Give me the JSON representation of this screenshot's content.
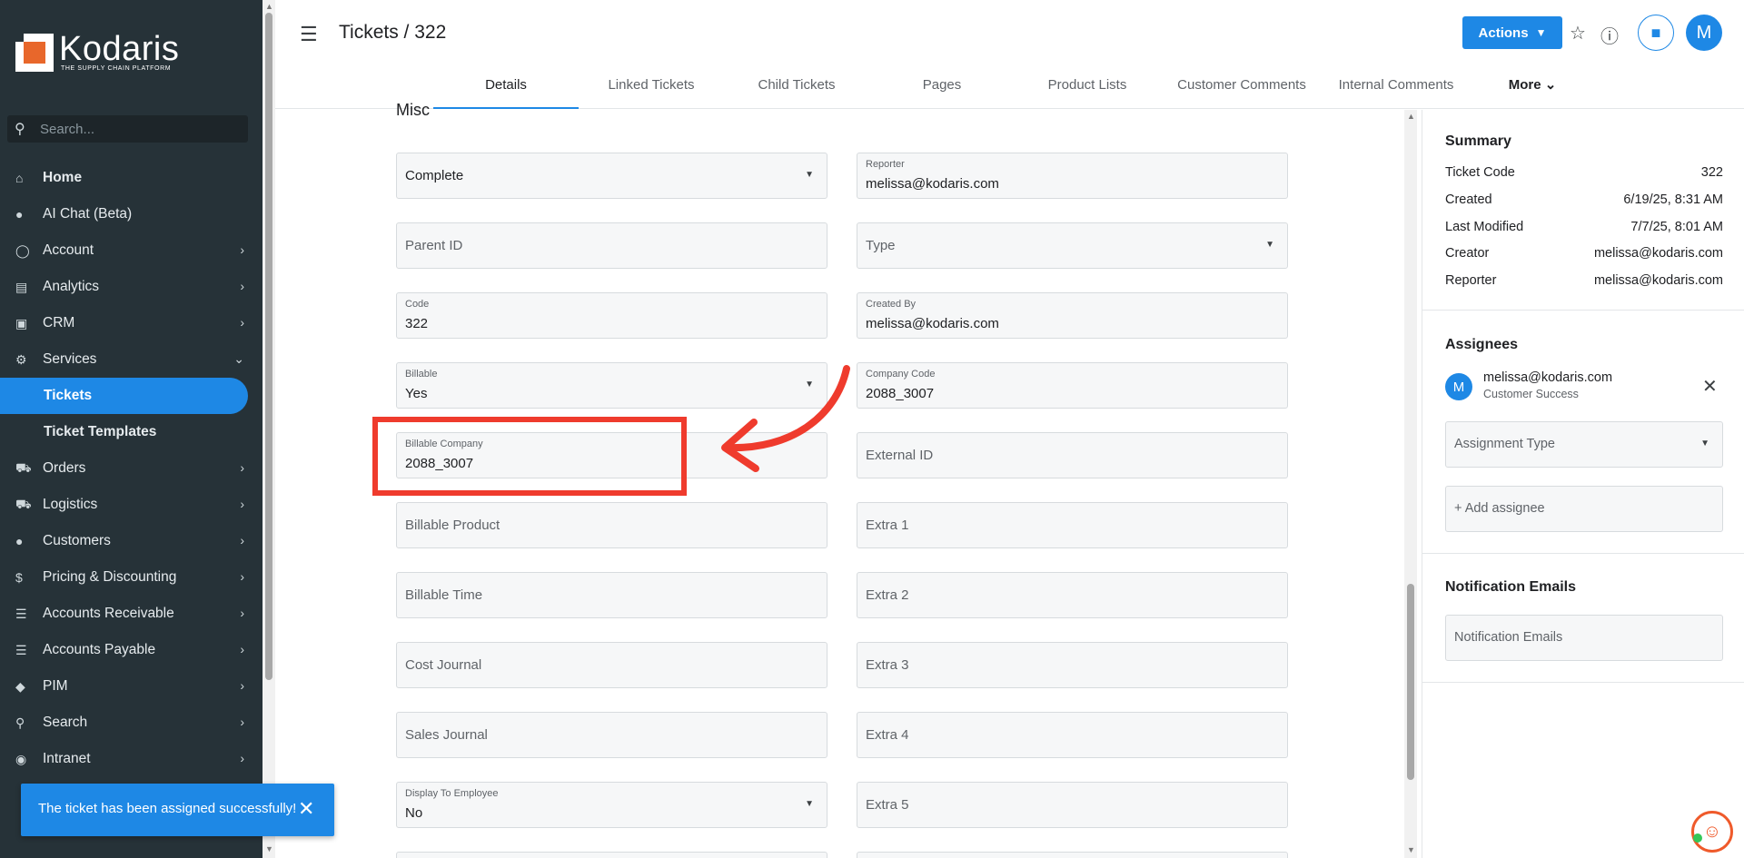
{
  "brand": {
    "name": "Kodaris",
    "tagline": "THE SUPPLY CHAIN PLATFORM"
  },
  "sidebar": {
    "search_placeholder": "Search...",
    "items": [
      {
        "label": "Home",
        "icon": "home-icon",
        "chevron": false
      },
      {
        "label": "AI Chat (Beta)",
        "icon": "robot-icon",
        "chevron": false
      },
      {
        "label": "Account",
        "icon": "person-icon",
        "chevron": true
      },
      {
        "label": "Analytics",
        "icon": "chart-icon",
        "chevron": true
      },
      {
        "label": "CRM",
        "icon": "contact-card-icon",
        "chevron": true
      },
      {
        "label": "Services",
        "icon": "gears-icon",
        "chevron": "down"
      },
      {
        "label": "Tickets",
        "icon": "",
        "chevron": false,
        "active": true
      },
      {
        "label": "Ticket Templates",
        "icon": "",
        "chevron": false
      },
      {
        "label": "Orders",
        "icon": "truck-icon",
        "chevron": true
      },
      {
        "label": "Logistics",
        "icon": "delivery-icon",
        "chevron": true
      },
      {
        "label": "Customers",
        "icon": "people-icon",
        "chevron": true
      },
      {
        "label": "Pricing & Discounting",
        "icon": "dollar-icon",
        "chevron": true
      },
      {
        "label": "Accounts Receivable",
        "icon": "bank-icon",
        "chevron": true
      },
      {
        "label": "Accounts Payable",
        "icon": "bank-icon",
        "chevron": true
      },
      {
        "label": "PIM",
        "icon": "tag-icon",
        "chevron": true
      },
      {
        "label": "Search",
        "icon": "search-icon",
        "chevron": true
      },
      {
        "label": "Intranet",
        "icon": "globe-icon",
        "chevron": true
      }
    ]
  },
  "header": {
    "title": "Tickets / 322",
    "actions_label": "Actions",
    "avatar_initial": "M",
    "tabs": [
      "Details",
      "Linked Tickets",
      "Child Tickets",
      "Pages",
      "Product Lists",
      "Customer Comments",
      "Internal Comments",
      "More"
    ]
  },
  "form": {
    "section_title": "Misc",
    "status": {
      "value": "Complete"
    },
    "reporter": {
      "label": "Reporter",
      "value": "melissa@kodaris.com"
    },
    "parent_id": {
      "placeholder": "Parent ID"
    },
    "type": {
      "placeholder": "Type"
    },
    "code": {
      "label": "Code",
      "value": "322"
    },
    "created_by": {
      "label": "Created By",
      "value": "melissa@kodaris.com"
    },
    "billable": {
      "label": "Billable",
      "value": "Yes"
    },
    "company_code": {
      "label": "Company Code",
      "value": "2088_3007"
    },
    "billable_company": {
      "label": "Billable Company",
      "value": "2088_3007"
    },
    "external_id": {
      "placeholder": "External ID"
    },
    "billable_product": {
      "placeholder": "Billable Product"
    },
    "extra1": {
      "placeholder": "Extra 1"
    },
    "billable_time": {
      "placeholder": "Billable Time"
    },
    "extra2": {
      "placeholder": "Extra 2"
    },
    "cost_journal": {
      "placeholder": "Cost Journal"
    },
    "extra3": {
      "placeholder": "Extra 3"
    },
    "sales_journal": {
      "placeholder": "Sales Journal"
    },
    "extra4": {
      "placeholder": "Extra 4"
    },
    "display_to_employee": {
      "label": "Display To Employee",
      "value": "No"
    },
    "extra5": {
      "placeholder": "Extra 5"
    }
  },
  "summary": {
    "title": "Summary",
    "rows": [
      {
        "key": "Ticket Code",
        "value": "322"
      },
      {
        "key": "Created",
        "value": "6/19/25, 8:31 AM"
      },
      {
        "key": "Last Modified",
        "value": "7/7/25, 8:01 AM"
      },
      {
        "key": "Creator",
        "value": "melissa@kodaris.com"
      },
      {
        "key": "Reporter",
        "value": "melissa@kodaris.com"
      }
    ]
  },
  "assignees": {
    "title": "Assignees",
    "list": [
      {
        "initial": "M",
        "email": "melissa@kodaris.com",
        "role": "Customer Success"
      }
    ],
    "assignment_type_placeholder": "Assignment Type",
    "add_label": "+ Add assignee"
  },
  "notifications": {
    "title": "Notification Emails",
    "placeholder": "Notification Emails"
  },
  "toast": {
    "message": "The ticket has been assigned successfully!"
  },
  "colors": {
    "accent": "#1e88e5",
    "sidebar": "#263238",
    "annotation": "#ef3b2d"
  }
}
